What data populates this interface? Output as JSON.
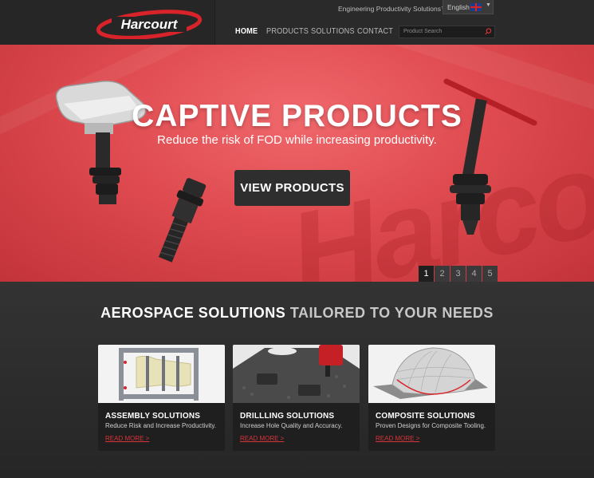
{
  "header": {
    "tagline": "Engineering Productivity Solutions™",
    "language": "English",
    "logo_text": "Harcourt",
    "nav": [
      "HOME",
      "PRODUCTS",
      "SOLUTIONS",
      "CONTACT"
    ],
    "search_placeholder": "Product Search"
  },
  "hero": {
    "title": "CAPTIVE PRODUCTS",
    "subtitle": "Reduce the risk of FOD while increasing productivity.",
    "button": "VIEW PRODUCTS",
    "slides": [
      "1",
      "2",
      "3",
      "4",
      "5"
    ],
    "active_slide": 1
  },
  "section": {
    "title_main": "AEROSPACE SOLUTIONS",
    "title_highlight": "TAILORED TO YOUR NEEDS",
    "cards": [
      {
        "title": "ASSEMBLY SOLUTIONS",
        "desc": "Reduce Risk and Increase Productivity.",
        "more": "READ MORE  >"
      },
      {
        "title": "DRILLLING SOLUTIONS",
        "desc": "Increase Hole Quality and Accuracy.",
        "more": "READ MORE  >"
      },
      {
        "title": "COMPOSITE SOLUTIONS",
        "desc": "Proven Designs for Composite Tooling.",
        "more": "READ MORE  >"
      }
    ]
  },
  "colors": {
    "brand_red": "#e0454b",
    "accent_link": "#d8333a",
    "dark_bg": "#2b2b2b"
  }
}
